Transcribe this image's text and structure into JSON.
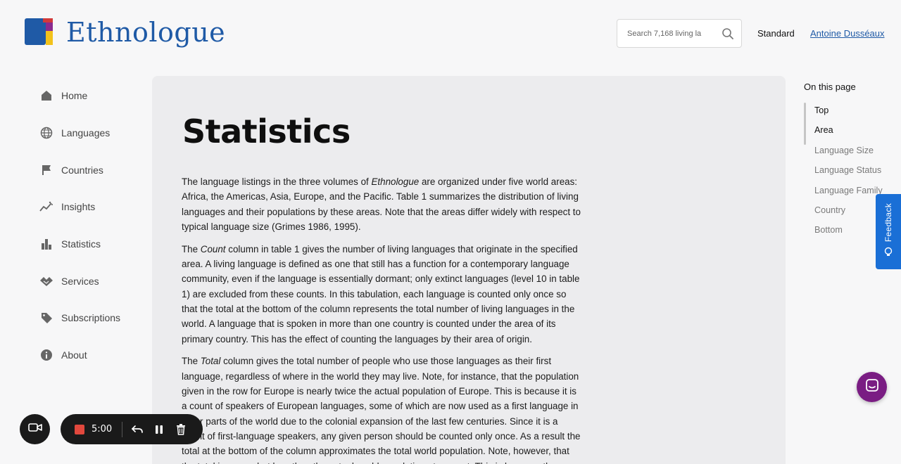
{
  "header": {
    "logo_text": "Ethnologue",
    "search_placeholder": "Search 7,168 living la",
    "standard_label": "Standard",
    "user_name": "Antoine Dusséaux"
  },
  "sidebar": {
    "items": [
      {
        "label": "Home",
        "icon": "home-icon"
      },
      {
        "label": "Languages",
        "icon": "globe-icon"
      },
      {
        "label": "Countries",
        "icon": "flag-icon"
      },
      {
        "label": "Insights",
        "icon": "insights-icon"
      },
      {
        "label": "Statistics",
        "icon": "bar-chart-icon"
      },
      {
        "label": "Services",
        "icon": "handshake-icon"
      },
      {
        "label": "Subscriptions",
        "icon": "tag-icon"
      },
      {
        "label": "About",
        "icon": "info-icon"
      }
    ]
  },
  "main": {
    "title": "Statistics",
    "p1_a": "The language listings in the three volumes of ",
    "p1_em": "Ethnologue",
    "p1_b": " are organized under five world areas: Africa, the Americas, Asia, Europe, and the Pacific. Table 1 summarizes the distribution of living languages and their populations by these areas. Note that the areas differ widely with respect to typical language size (Grimes 1986, 1995).",
    "p2_a": "The ",
    "p2_em": "Count",
    "p2_b": " column in table 1 gives the number of living languages that originate in the specified area. A living language is defined as one that still has a function for a contemporary language community, even if the language is essentially dormant; only extinct languages (level 10 in table 1) are excluded from these counts. In this tabulation, each language is counted only once so that the total at the bottom of the column represents the total number of living languages in the world. A language that is spoken in more than one country is counted under the area of its primary country. This has the effect of counting the languages by their area of origin.",
    "p3_a": "The ",
    "p3_em": "Total",
    "p3_b": " column gives the total number of people who use those languages as their first language, regardless of where in the world they may live. Note, for instance, that the population given in the row for Europe is nearly twice the actual population of Europe. This is because it is a count of speakers of European languages, some of which are now used as a first language in other parts of the world due to the colonial expansion of the last few centuries. Since it is a count of first-language speakers, any given person should be counted only once. As a result the total at the bottom of the column approximates the total world population. Note, however, that the total is somewhat less than the actual world population at present. This is because the"
  },
  "toc": {
    "title": "On this page",
    "items": [
      "Top",
      "Area",
      "Language Size",
      "Language Status",
      "Language Family",
      "Country",
      "Bottom"
    ]
  },
  "feedback": {
    "label": "Feedback"
  },
  "recorder": {
    "time": "5:00"
  },
  "colors": {
    "brand_blue": "#1f5aa6",
    "feedback_blue": "#1a6fd6",
    "chat_purple": "#7a1d83",
    "record_red": "#e2483d"
  }
}
